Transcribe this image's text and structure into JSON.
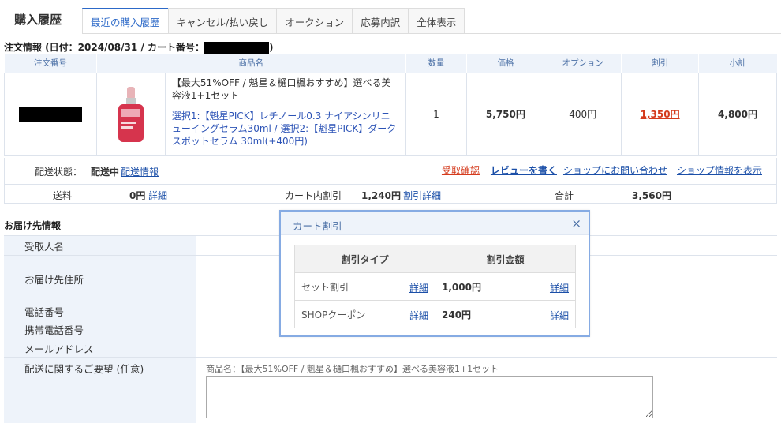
{
  "header": {
    "title": "購入履歴",
    "tabs": [
      {
        "label": "最近の購入履歴",
        "active": true
      },
      {
        "label": "キャンセル/払い戻し"
      },
      {
        "label": "オークション"
      },
      {
        "label": "応募内訳"
      },
      {
        "label": "全体表示"
      }
    ]
  },
  "order": {
    "heading": "注文情報 (日付：2024/08/31 / カート番号：",
    "heading_close": ")",
    "columns": [
      "注文番号",
      "商品名",
      "数量",
      "価格",
      "オプション",
      "割引",
      "小計"
    ],
    "product_name": "【最大51%OFF / 魁星＆樋口楓おすすめ】選べる美容液1+1セット",
    "product_option": "選択1:【魁星PICK】レチノール0.3 ナイアシンリニューイングセラム30ml / 選択2:【魁星PICK】ダークスポットセラム 30ml(+400円)",
    "quantity": "1",
    "price": "5,750円",
    "option_price": "400円",
    "discount": "1,350円",
    "subtotal": "4,800円",
    "status_label": "配送状態：",
    "status_value": "配送中",
    "ship_info": "配送情報",
    "links": {
      "receipt": "受取確認",
      "review": "レビューを書く",
      "inquiry": "ショップにお問い合わせ",
      "shop_info": "ショップ情報を表示"
    },
    "totals": {
      "shipping_label": "送料",
      "shipping_value": "0円",
      "shipping_detail": "詳細",
      "cart_discount_label": "カート内割引",
      "cart_discount_value": "1,240円",
      "cart_discount_detail": "割引詳細",
      "total_label": "合計",
      "total_value": "3,560円"
    }
  },
  "delivery": {
    "heading": "お届け先情報",
    "rows": [
      "受取人名",
      "お届け先住所",
      "電話番号",
      "携帯電話番号",
      "メールアドレス",
      "配送に関するご要望 (任意)"
    ],
    "request_note": "商品名：【最大51%OFF / 魁星＆樋口楓おすすめ】選べる美容液1+1セット"
  },
  "popup": {
    "title": "カート割引",
    "close_icon": "×",
    "headers": [
      "割引タイプ",
      "割引金額"
    ],
    "rows": [
      {
        "type": "セット割引",
        "detail": "詳細",
        "amount": "1,000円",
        "amount_detail": "詳細"
      },
      {
        "type": "SHOPクーポン",
        "detail": "詳細",
        "amount": "240円",
        "amount_detail": "詳細"
      }
    ]
  }
}
